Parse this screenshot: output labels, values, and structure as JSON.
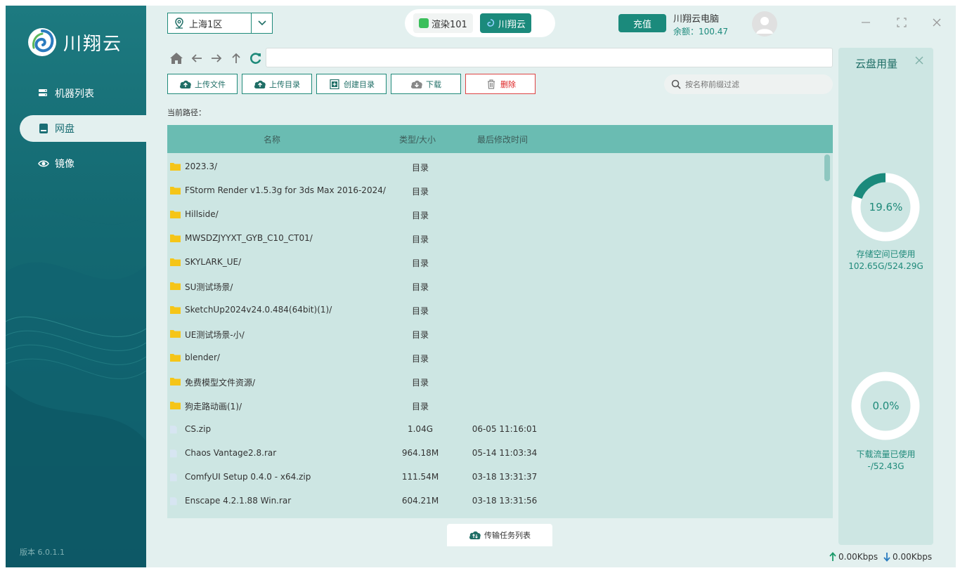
{
  "sidebar": {
    "logo_text": "川翔云",
    "items": [
      {
        "label": "机器列表",
        "icon": "server-icon"
      },
      {
        "label": "网盘",
        "icon": "disk-icon"
      },
      {
        "label": "镜像",
        "icon": "image-icon"
      }
    ],
    "active_index": 1,
    "version": "版本 6.0.1.1"
  },
  "header": {
    "region": "上海1区",
    "apps": [
      {
        "label": "渲染101",
        "active": false
      },
      {
        "label": "川翔云",
        "active": true
      }
    ],
    "recharge_label": "充值",
    "user_name": "川翔云电脑",
    "balance": "余额：100.47"
  },
  "path_input": {
    "value": ""
  },
  "toolbar": {
    "upload_file": "上传文件",
    "upload_dir": "上传目录",
    "create_dir": "创建目录",
    "download": "下载",
    "delete": "删除",
    "search_placeholder": "按名称前缀过滤"
  },
  "current_path_label": "当前路径：",
  "table": {
    "columns": {
      "name": "名称",
      "type_size": "类型/大小",
      "modified": "最后修改时间"
    },
    "rows": [
      {
        "name": "2023.3/",
        "type": "目录",
        "time": "",
        "kind": "folder"
      },
      {
        "name": "FStorm Render v1.5.3g for 3ds Max 2016-2024/",
        "type": "目录",
        "time": "",
        "kind": "folder"
      },
      {
        "name": "Hillside/",
        "type": "目录",
        "time": "",
        "kind": "folder"
      },
      {
        "name": "MWSDZJYYXT_GYB_C10_CT01/",
        "type": "目录",
        "time": "",
        "kind": "folder"
      },
      {
        "name": "SKYLARK_UE/",
        "type": "目录",
        "time": "",
        "kind": "folder"
      },
      {
        "name": "SU测试场景/",
        "type": "目录",
        "time": "",
        "kind": "folder"
      },
      {
        "name": "SketchUp2024v24.0.484(64bit)(1)/",
        "type": "目录",
        "time": "",
        "kind": "folder"
      },
      {
        "name": "UE测试场景-小/",
        "type": "目录",
        "time": "",
        "kind": "folder"
      },
      {
        "name": "blender/",
        "type": "目录",
        "time": "",
        "kind": "folder"
      },
      {
        "name": "免费模型文件资源/",
        "type": "目录",
        "time": "",
        "kind": "folder"
      },
      {
        "name": "狗走路动画(1)/",
        "type": "目录",
        "time": "",
        "kind": "folder"
      },
      {
        "name": "CS.zip",
        "type": "1.04G",
        "time": "06-05 11:16:01",
        "kind": "file"
      },
      {
        "name": "Chaos Vantage2.8.rar",
        "type": "964.18M",
        "time": "05-14 11:03:34",
        "kind": "file"
      },
      {
        "name": "ComfyUI Setup 0.4.0 - x64.zip",
        "type": "111.54M",
        "time": "03-18 13:31:37",
        "kind": "file"
      },
      {
        "name": "Enscape 4.2.1.88 Win.rar",
        "type": "604.21M",
        "time": "03-18 13:31:56",
        "kind": "file"
      }
    ]
  },
  "transfer_label": "传输任务列表",
  "usage_panel": {
    "title": "云盘用量",
    "storage": {
      "percent_text": "19.6%",
      "fraction": 0.196,
      "label": "存储空间已使用",
      "value": "102.65G/524.29G"
    },
    "traffic": {
      "percent_text": "0.0%",
      "fraction": 0.0,
      "label": "下载流量已使用",
      "value": "-/52.43G"
    }
  },
  "speed": {
    "up": "0.00Kbps",
    "down": "0.00Kbps"
  },
  "colors": {
    "accent": "#1b8a7c",
    "header_row": "#6abcb2",
    "table_bg": "#cde6e3",
    "folder": "#f5c518",
    "danger": "#dd2222"
  }
}
